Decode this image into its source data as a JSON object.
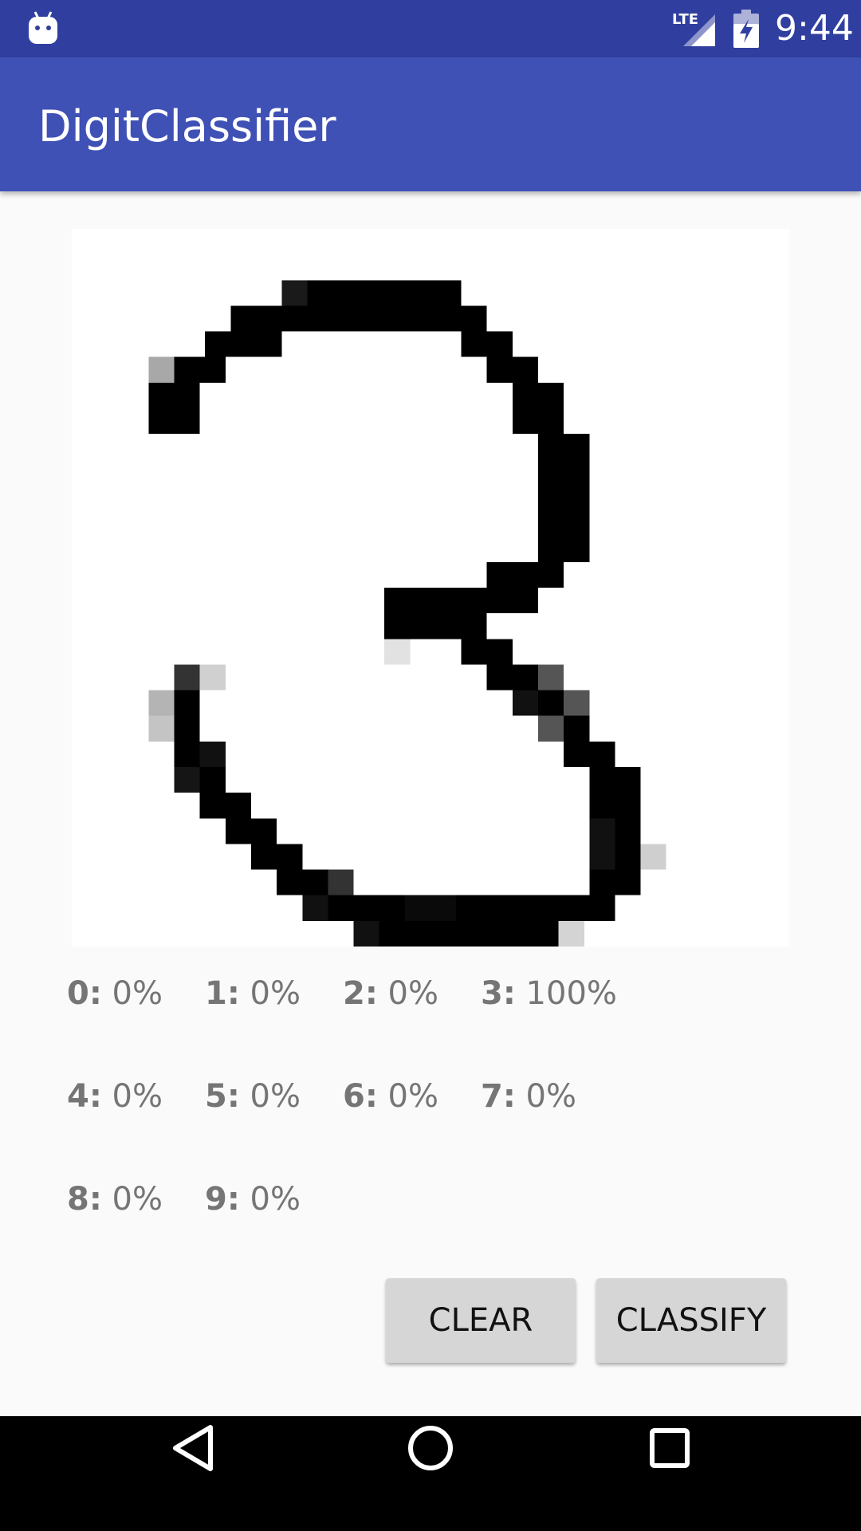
{
  "status_bar": {
    "time": "9:44",
    "network": "LTE",
    "icons": [
      "android-debug-icon",
      "lte-signal-icon",
      "battery-charging-icon"
    ]
  },
  "app_bar": {
    "title": "DigitClassifier"
  },
  "results": [
    {
      "digit": "0:",
      "value": "0%"
    },
    {
      "digit": "1:",
      "value": "0%"
    },
    {
      "digit": "2:",
      "value": "0%"
    },
    {
      "digit": "3:",
      "value": "100%"
    },
    {
      "digit": "4:",
      "value": "0%"
    },
    {
      "digit": "5:",
      "value": "0%"
    },
    {
      "digit": "6:",
      "value": "0%"
    },
    {
      "digit": "7:",
      "value": "0%"
    },
    {
      "digit": "8:",
      "value": "0%"
    },
    {
      "digit": "9:",
      "value": "0%"
    }
  ],
  "buttons": {
    "clear": "CLEAR",
    "classify": "CLASSIFY"
  },
  "nav_bar": {
    "icons": [
      "back-icon",
      "home-icon",
      "recents-icon"
    ]
  },
  "colors": {
    "status_bar": "#303f9f",
    "app_bar": "#3f51b5",
    "background": "#fafafa",
    "button": "#d6d6d6"
  }
}
